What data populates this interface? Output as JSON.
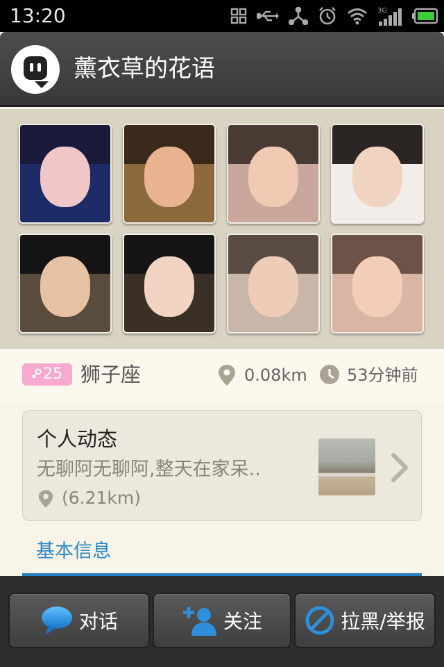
{
  "status_bar": {
    "time": "13:20",
    "icons": [
      "grid-icon",
      "usb-icon",
      "share-icon",
      "alarm-icon",
      "wifi-icon",
      "signal-3g-icon",
      "battery-icon"
    ],
    "network_label": "3G"
  },
  "header": {
    "title": "薰衣草的花语",
    "logo_icon": "chat-bubble-logo-icon"
  },
  "photos": {
    "count": 8,
    "palettes": [
      {
        "bg": "#1d2b66",
        "face": "#f0c6c8",
        "hair": "#1a1a3a"
      },
      {
        "bg": "#8c6a3e",
        "face": "#e9b38f",
        "hair": "#3a2a1c"
      },
      {
        "bg": "#c9a79c",
        "face": "#efc9b2",
        "hair": "#4a3a34"
      },
      {
        "bg": "#f2ede8",
        "face": "#f1d3c2",
        "hair": "#2b2624"
      },
      {
        "bg": "#5a4c3c",
        "face": "#e7c1a3",
        "hair": "#141414"
      },
      {
        "bg": "#3a3026",
        "face": "#f0d3c1",
        "hair": "#151515"
      },
      {
        "bg": "#c8b7a9",
        "face": "#efccb7",
        "hair": "#5a4c45"
      },
      {
        "bg": "#d9b6a4",
        "face": "#f3cdb8",
        "hair": "#6c5247"
      }
    ]
  },
  "profile": {
    "age_badge": "25",
    "gender_icon": "female-icon",
    "zodiac": "狮子座",
    "distance": "0.08km",
    "last_active": "53分钟前"
  },
  "moment": {
    "title": "个人动态",
    "text": "无聊阿无聊阿,整天在家呆..",
    "location": "(6.21km)"
  },
  "tabs": {
    "basic_info": "基本信息"
  },
  "actions": {
    "chat": "对话",
    "follow": "关注",
    "block_report": "拉黑/举报"
  },
  "colors": {
    "accent": "#2a88c8",
    "badge_pink": "#f7a9cf",
    "header_bg": "#404040",
    "bottom_bar": "#2e2e2e"
  }
}
